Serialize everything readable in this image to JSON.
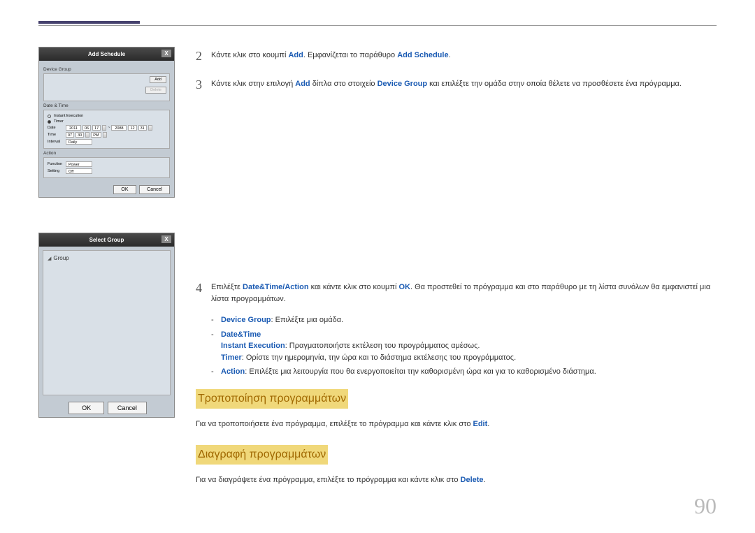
{
  "addSchedule": {
    "title": "Add Schedule",
    "deviceGroupLabel": "Device Group",
    "addBtn": "Add",
    "deleteBtn": "Delete",
    "dateTimeLabel": "Date & Time",
    "instantExec": "Instant Execution",
    "timer": "Timer",
    "dateLabel": "Date",
    "dateY1": "2011",
    "dateM1": "06",
    "dateD1": "17",
    "dateTo": "~",
    "dateY2": "2088",
    "dateM2": "12",
    "dateD2": "31",
    "timeLabel": "Time",
    "timeH": "07",
    "timeM": "30",
    "timeAP": "PM",
    "intervalLabel": "Interval",
    "intervalVal": "Daily",
    "actionLabel": "Action",
    "functionLabel": "Function",
    "functionVal": "Power",
    "settingLabel": "Setting",
    "settingVal": "Off",
    "ok": "OK",
    "cancel": "Cancel"
  },
  "selectGroup": {
    "title": "Select Group",
    "groupItem": "Group",
    "ok": "OK",
    "cancel": "Cancel"
  },
  "steps": {
    "s2": {
      "num": "2",
      "t1": "Κάντε κλικ στο κουμπί ",
      "add": "Add",
      "t2": ". Εμφανίζεται το παράθυρο ",
      "addSchedule": "Add Schedule",
      "t3": "."
    },
    "s3": {
      "num": "3",
      "t1": "Κάντε κλικ στην επιλογή ",
      "add": "Add",
      "t2": " δίπλα στο στοιχείο ",
      "dg": "Device Group",
      "t3": " και επιλέξτε την ομάδα στην οποία θέλετε να προσθέσετε ένα πρόγραμμα."
    },
    "s4": {
      "num": "4",
      "t1": "Επιλέξτε ",
      "dta": "Date&Time/Action",
      "t2": " και κάντε κλικ στο κουμπί ",
      "ok": "OK",
      "t3": ". Θα προστεθεί το πρόγραμμα και στο παράθυρο με τη λίστα συνόλων θα εμφανιστεί μια λίστα προγραμμάτων."
    }
  },
  "bullets": {
    "b1": {
      "dg": "Device Group",
      "t": ": Επιλέξτε μια ομάδα."
    },
    "b2": {
      "dt": "Date&Time"
    },
    "b2a": {
      "ie": "Instant Execution",
      "t": ": Πραγματοποιήστε εκτέλεση του προγράμματος αμέσως."
    },
    "b2b": {
      "tm": "Timer",
      "t": ": Ορίστε την ημερομηνία, την ώρα και το διάστημα εκτέλεσης του προγράμματος."
    },
    "b3": {
      "ac": "Action",
      "t": ": Επιλέξτε μια λειτουργία που θα ενεργοποιείται την καθορισμένη ώρα και για το καθορισμένο διάστημα."
    }
  },
  "sections": {
    "modify": "Τροποποίηση προγραμμάτων",
    "modifyText": {
      "t1": "Για να τροποποιήσετε ένα πρόγραμμα, επιλέξτε το πρόγραμμα και κάντε κλικ στο ",
      "edit": "Edit",
      "t2": "."
    },
    "delete": "Διαγραφή προγραμμάτων",
    "deleteText": {
      "t1": "Για να διαγράψετε ένα πρόγραμμα, επιλέξτε το πρόγραμμα και κάντε κλικ στο ",
      "del": "Delete",
      "t2": "."
    }
  },
  "pageNum": "90"
}
